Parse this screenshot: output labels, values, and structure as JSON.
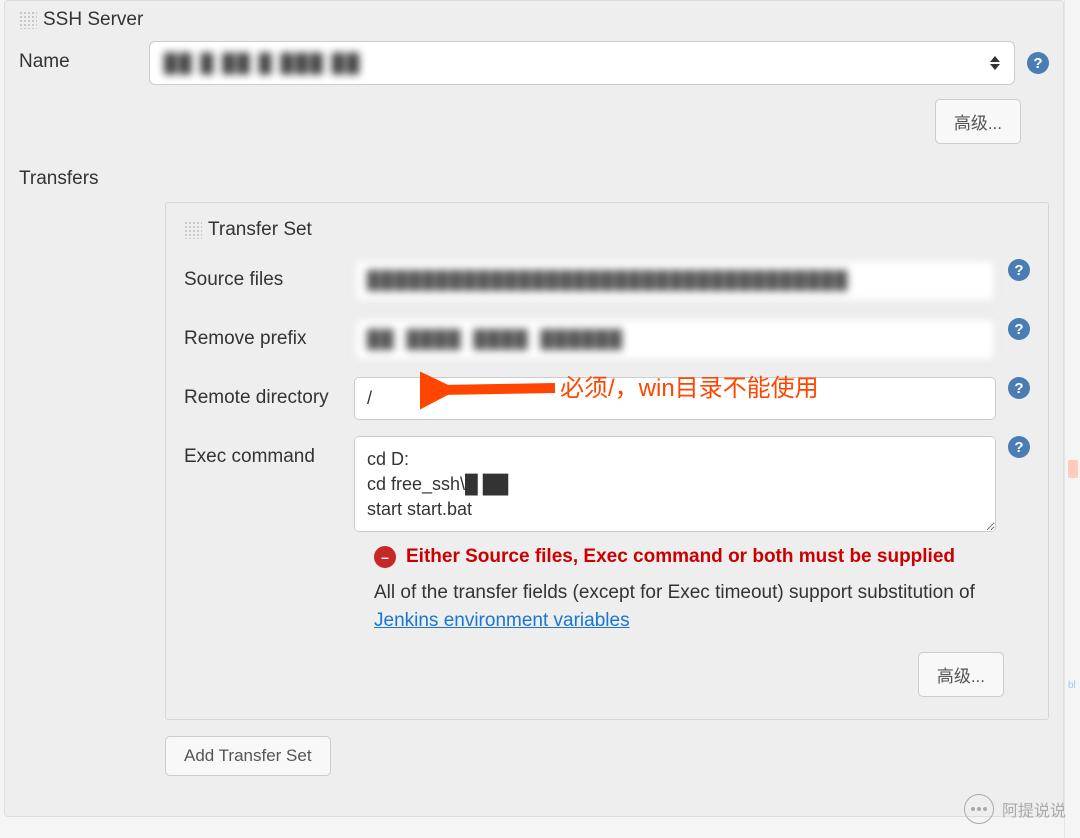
{
  "ssh_server": {
    "title": "SSH Server",
    "name_label": "Name",
    "name_value": "██ █ ██ █ ███ ██",
    "advanced_btn": "高级..."
  },
  "transfers": {
    "label": "Transfers",
    "set_title": "Transfer Set",
    "source_files": {
      "label": "Source files",
      "value": "███████████████████████████████████"
    },
    "remove_prefix": {
      "label": "Remove prefix",
      "value": "██  ████  ████  ██████"
    },
    "remote_directory": {
      "label": "Remote directory",
      "value": "/"
    },
    "exec_command": {
      "label": "Exec command",
      "value": "cd D:\ncd free_ssh\\█ ██\nstart start.bat"
    },
    "error": "Either Source files, Exec command or both must be supplied",
    "info_prefix": "All of the transfer fields (except for Exec timeout) support substitution of ",
    "info_link": "Jenkins environment variables",
    "advanced_btn": "高级...",
    "add_set_btn": "Add Transfer Set"
  },
  "annotation": "必须/，win目录不能使用",
  "watermark": "阿提说说"
}
